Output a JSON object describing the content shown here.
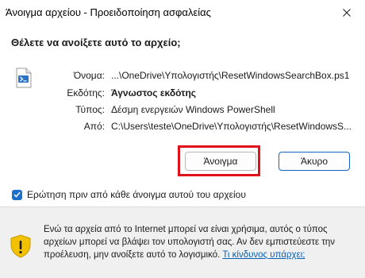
{
  "window": {
    "title": "Άνοιγμα αρχείου - Προειδοποίηση ασφαλείας"
  },
  "dialog": {
    "question": "Θέλετε να ανοίξετε αυτό το αρχείο;",
    "file_icon": "powershell-script-icon",
    "fields": [
      {
        "label": "Όνομα:",
        "value": "...\\OneDrive\\Υπολογιστής\\ResetWindowsSearchBox.ps1"
      },
      {
        "label": "Εκδότης:",
        "value": "Άγνωστος εκδότης"
      },
      {
        "label": "Τύπος:",
        "value": "Δέσμη ενεργειών Windows PowerShell"
      },
      {
        "label": "Από:",
        "value": "C:\\Users\\teste\\OneDrive\\Υπολογιστής\\ResetWindowsS..."
      }
    ],
    "buttons": {
      "open": "Άνοιγμα",
      "cancel": "Άκυρο"
    },
    "checkbox": {
      "label": "Ερώτηση πριν από κάθε άνοιγμα αυτού του αρχείου",
      "checked": true
    }
  },
  "footer": {
    "warning_icon": "shield-warning-icon",
    "warning_text": "Ενώ τα αρχεία από το Internet μπορεί να είναι χρήσιμα, αυτός ο τύπος αρχείων μπορεί να βλάψει τον υπολογιστή σας. Αν δεν εμπιστεύεστε την προέλευση, μην ανοίξετε αυτό το λογισμικό.",
    "link_text": "Τι κίνδυνος υπάρχει;"
  },
  "colors": {
    "accent": "#1d6fcc",
    "highlight": "#e0111b",
    "link": "#0a5fb5",
    "shield": "#f2c200"
  }
}
